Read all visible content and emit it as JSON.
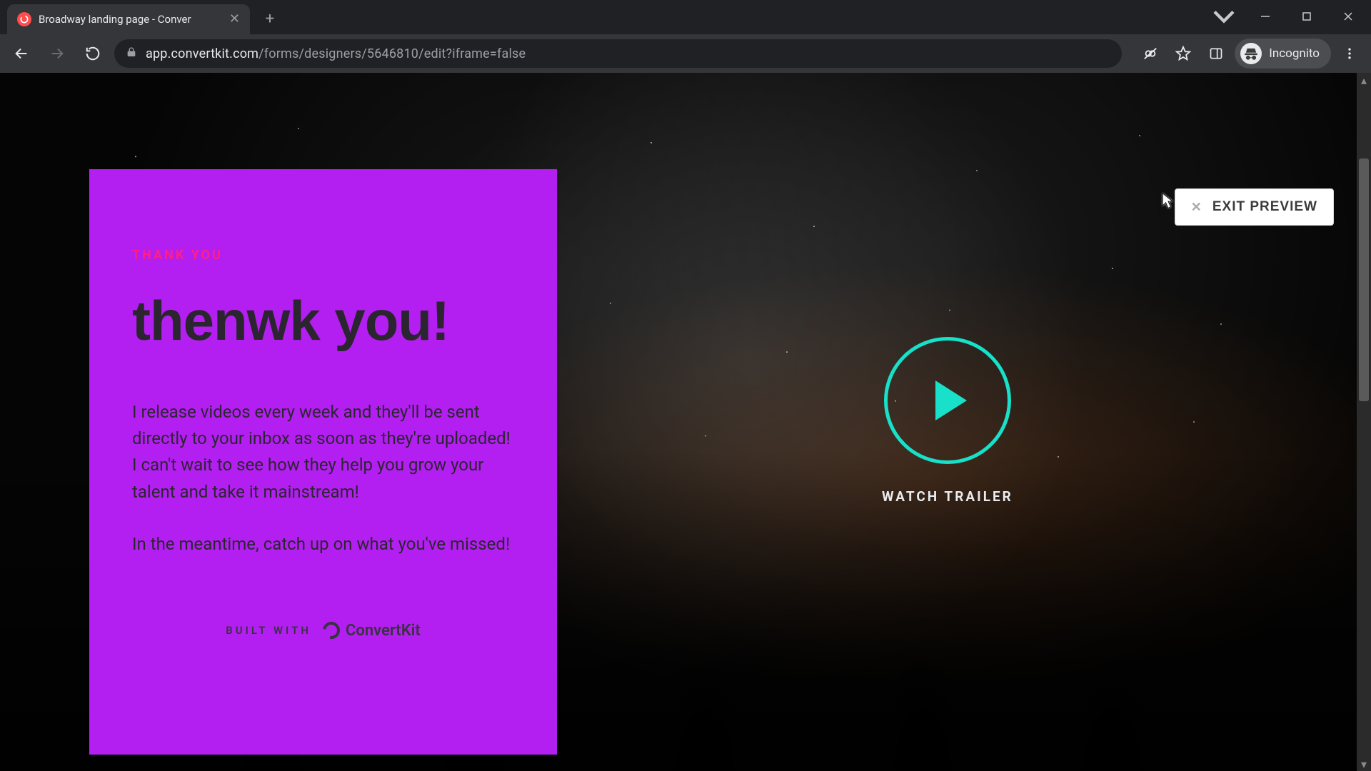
{
  "browser": {
    "tab_title": "Broadway landing page - Conver",
    "url_host": "app.convertkit.com",
    "url_path": "/forms/designers/5646810/edit?iframe=false",
    "incognito_label": "Incognito"
  },
  "preview": {
    "exit_label": "EXIT PREVIEW"
  },
  "card": {
    "eyebrow": "THANK YOU",
    "headline": "thenwk you!",
    "paragraph1": "I release videos every week and they'll be sent directly to your inbox as soon as they're uploaded! I can't wait to see how they help you grow your talent and take it mainstream!",
    "paragraph2": "In the meantime, catch up on what you've missed!",
    "built_with_label": "BUILT WITH",
    "built_with_brand": "ConvertKit"
  },
  "video": {
    "watch_label": "WATCH TRAILER"
  },
  "colors": {
    "card_bg": "#b31ff0",
    "eyebrow": "#ff1f87",
    "play_accent": "#18e0c9"
  }
}
